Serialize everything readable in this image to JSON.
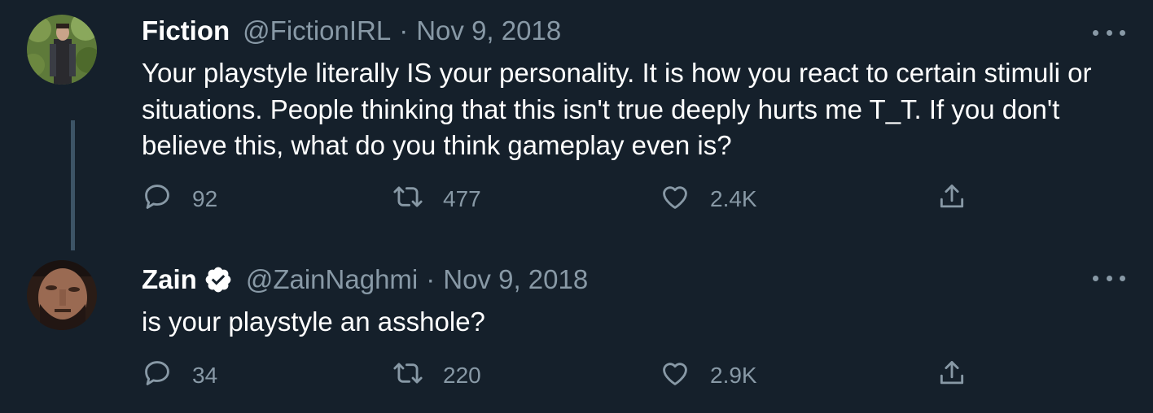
{
  "tweets": [
    {
      "author": {
        "name": "Fiction",
        "handle": "@FictionIRL",
        "verified": false
      },
      "separator": "·",
      "date": "Nov 9, 2018",
      "text": "Your playstyle literally IS your personality. It is how you react to certain stimuli or situations. People thinking that this isn't true deeply hurts me T_T. If you don't believe this, what do you think gameplay even is?",
      "stats": {
        "replies": "92",
        "retweets": "477",
        "likes": "2.4K"
      }
    },
    {
      "author": {
        "name": "Zain",
        "handle": "@ZainNaghmi",
        "verified": true
      },
      "separator": "·",
      "date": "Nov 9, 2018",
      "text": "is your playstyle an asshole?",
      "stats": {
        "replies": "34",
        "retweets": "220",
        "likes": "2.9K"
      }
    }
  ],
  "icons": {
    "reply": "reply-icon",
    "retweet": "retweet-icon",
    "like": "heart-icon",
    "share": "share-icon",
    "more": "more-icon",
    "verified": "verified-badge-icon"
  },
  "colors": {
    "background": "#15202b",
    "text": "#ffffff",
    "secondary": "#8899a6",
    "verified": "#ffffff",
    "thread_line": "#3d5466"
  }
}
